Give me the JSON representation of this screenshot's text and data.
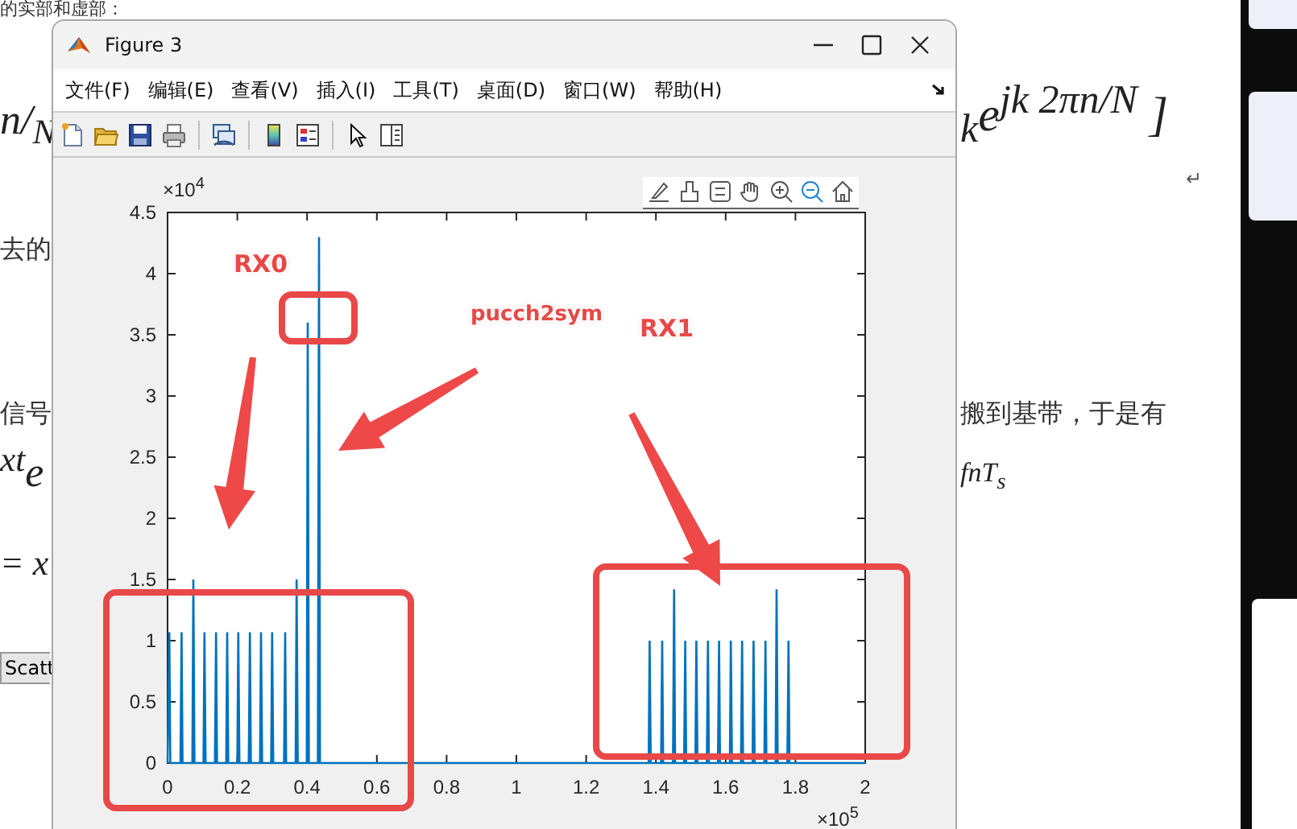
{
  "document": {
    "lines": [
      {
        "left": {
          "kind": "text",
          "text": "的实部和虚部："
        }
      },
      {
        "left": {
          "kind": "math",
          "text": "n/$_{N}$"
        },
        "right": {
          "kind": "math",
          "text": "$_{k}$e$^{jk 2πn/N}$ ]"
        }
      },
      {
        "right": {
          "kind": "mark",
          "text": "↵"
        }
      },
      {
        "left": {
          "kind": "text",
          "text": "去的"
        }
      },
      {
        "left": {
          "kind": "text",
          "text": "信号"
        },
        "right": {
          "kind": "text",
          "text": "搬到基带，于是有"
        }
      },
      {
        "left": {
          "kind": "math",
          "text": "$^{xt}$e"
        },
        "right": {
          "kind": "math",
          "text": "fnT$_{s}$"
        }
      },
      {
        "left": {
          "kind": "math",
          "text": "= x"
        }
      }
    ],
    "button": "Scatt"
  },
  "figure_window": {
    "title": "Figure 3",
    "menu": [
      "文件(F)",
      "编辑(E)",
      "查看(V)",
      "插入(I)",
      "工具(T)",
      "桌面(D)",
      "窗口(W)",
      "帮助(H)"
    ],
    "y_multiplier": "×10$^{4}$",
    "x_multiplier": "×10$^{5}$",
    "callouts": [
      {
        "text": "RX0"
      },
      {
        "text": "pucch2sym"
      },
      {
        "text": "RX1"
      }
    ],
    "chart_data": {
      "type": "line",
      "xlim": [
        0,
        2
      ],
      "ylim": [
        0,
        4.5
      ],
      "xticks": [
        0,
        0.2,
        0.4,
        0.6,
        0.8,
        1,
        1.2,
        1.4,
        1.6,
        1.8,
        2
      ],
      "yticks": [
        0,
        0.5,
        1,
        1.5,
        2,
        2.5,
        3,
        3.5,
        4,
        4.5
      ],
      "x": [
        0,
        0.005,
        0.008,
        0.037,
        0.04,
        0.043,
        0.071,
        0.074,
        0.077,
        0.103,
        0.106,
        0.109,
        0.136,
        0.139,
        0.142,
        0.168,
        0.171,
        0.174,
        0.2,
        0.203,
        0.206,
        0.233,
        0.236,
        0.239,
        0.265,
        0.268,
        0.271,
        0.297,
        0.3,
        0.303,
        0.334,
        0.337,
        0.34,
        0.367,
        0.37,
        0.373,
        0.399,
        0.402,
        0.405,
        0.431,
        0.434,
        0.437,
        1.379,
        1.382,
        1.385,
        1.415,
        1.418,
        1.421,
        1.449,
        1.452,
        1.455,
        1.481,
        1.484,
        1.487,
        1.513,
        1.516,
        1.519,
        1.546,
        1.549,
        1.552,
        1.578,
        1.581,
        1.584,
        1.612,
        1.615,
        1.618,
        1.644,
        1.647,
        1.65,
        1.677,
        1.68,
        1.683,
        1.711,
        1.714,
        1.717,
        1.743,
        1.746,
        1.749,
        1.777,
        1.78,
        1.783,
        2
      ],
      "series": [
        {
          "color": "#0072bd",
          "values": [
            0,
            1.07,
            0,
            0,
            1.07,
            0,
            0,
            1.5,
            0,
            0,
            1.07,
            0,
            0,
            1.07,
            0,
            0,
            1.07,
            0,
            0,
            1.07,
            0,
            0,
            1.07,
            0,
            0,
            1.07,
            0,
            0,
            1.07,
            0,
            0,
            1.07,
            0,
            0,
            1.5,
            0,
            0,
            3.6,
            0,
            0,
            4.3,
            0,
            0,
            1,
            0,
            0,
            1,
            0,
            0,
            1.42,
            0,
            0,
            1,
            0,
            0,
            1,
            0,
            0,
            1,
            0,
            0,
            1,
            0,
            0,
            1,
            0,
            0,
            1,
            0,
            0,
            1,
            0,
            0,
            1,
            0,
            0,
            1.42,
            0,
            0,
            1,
            0,
            0
          ]
        }
      ]
    }
  }
}
